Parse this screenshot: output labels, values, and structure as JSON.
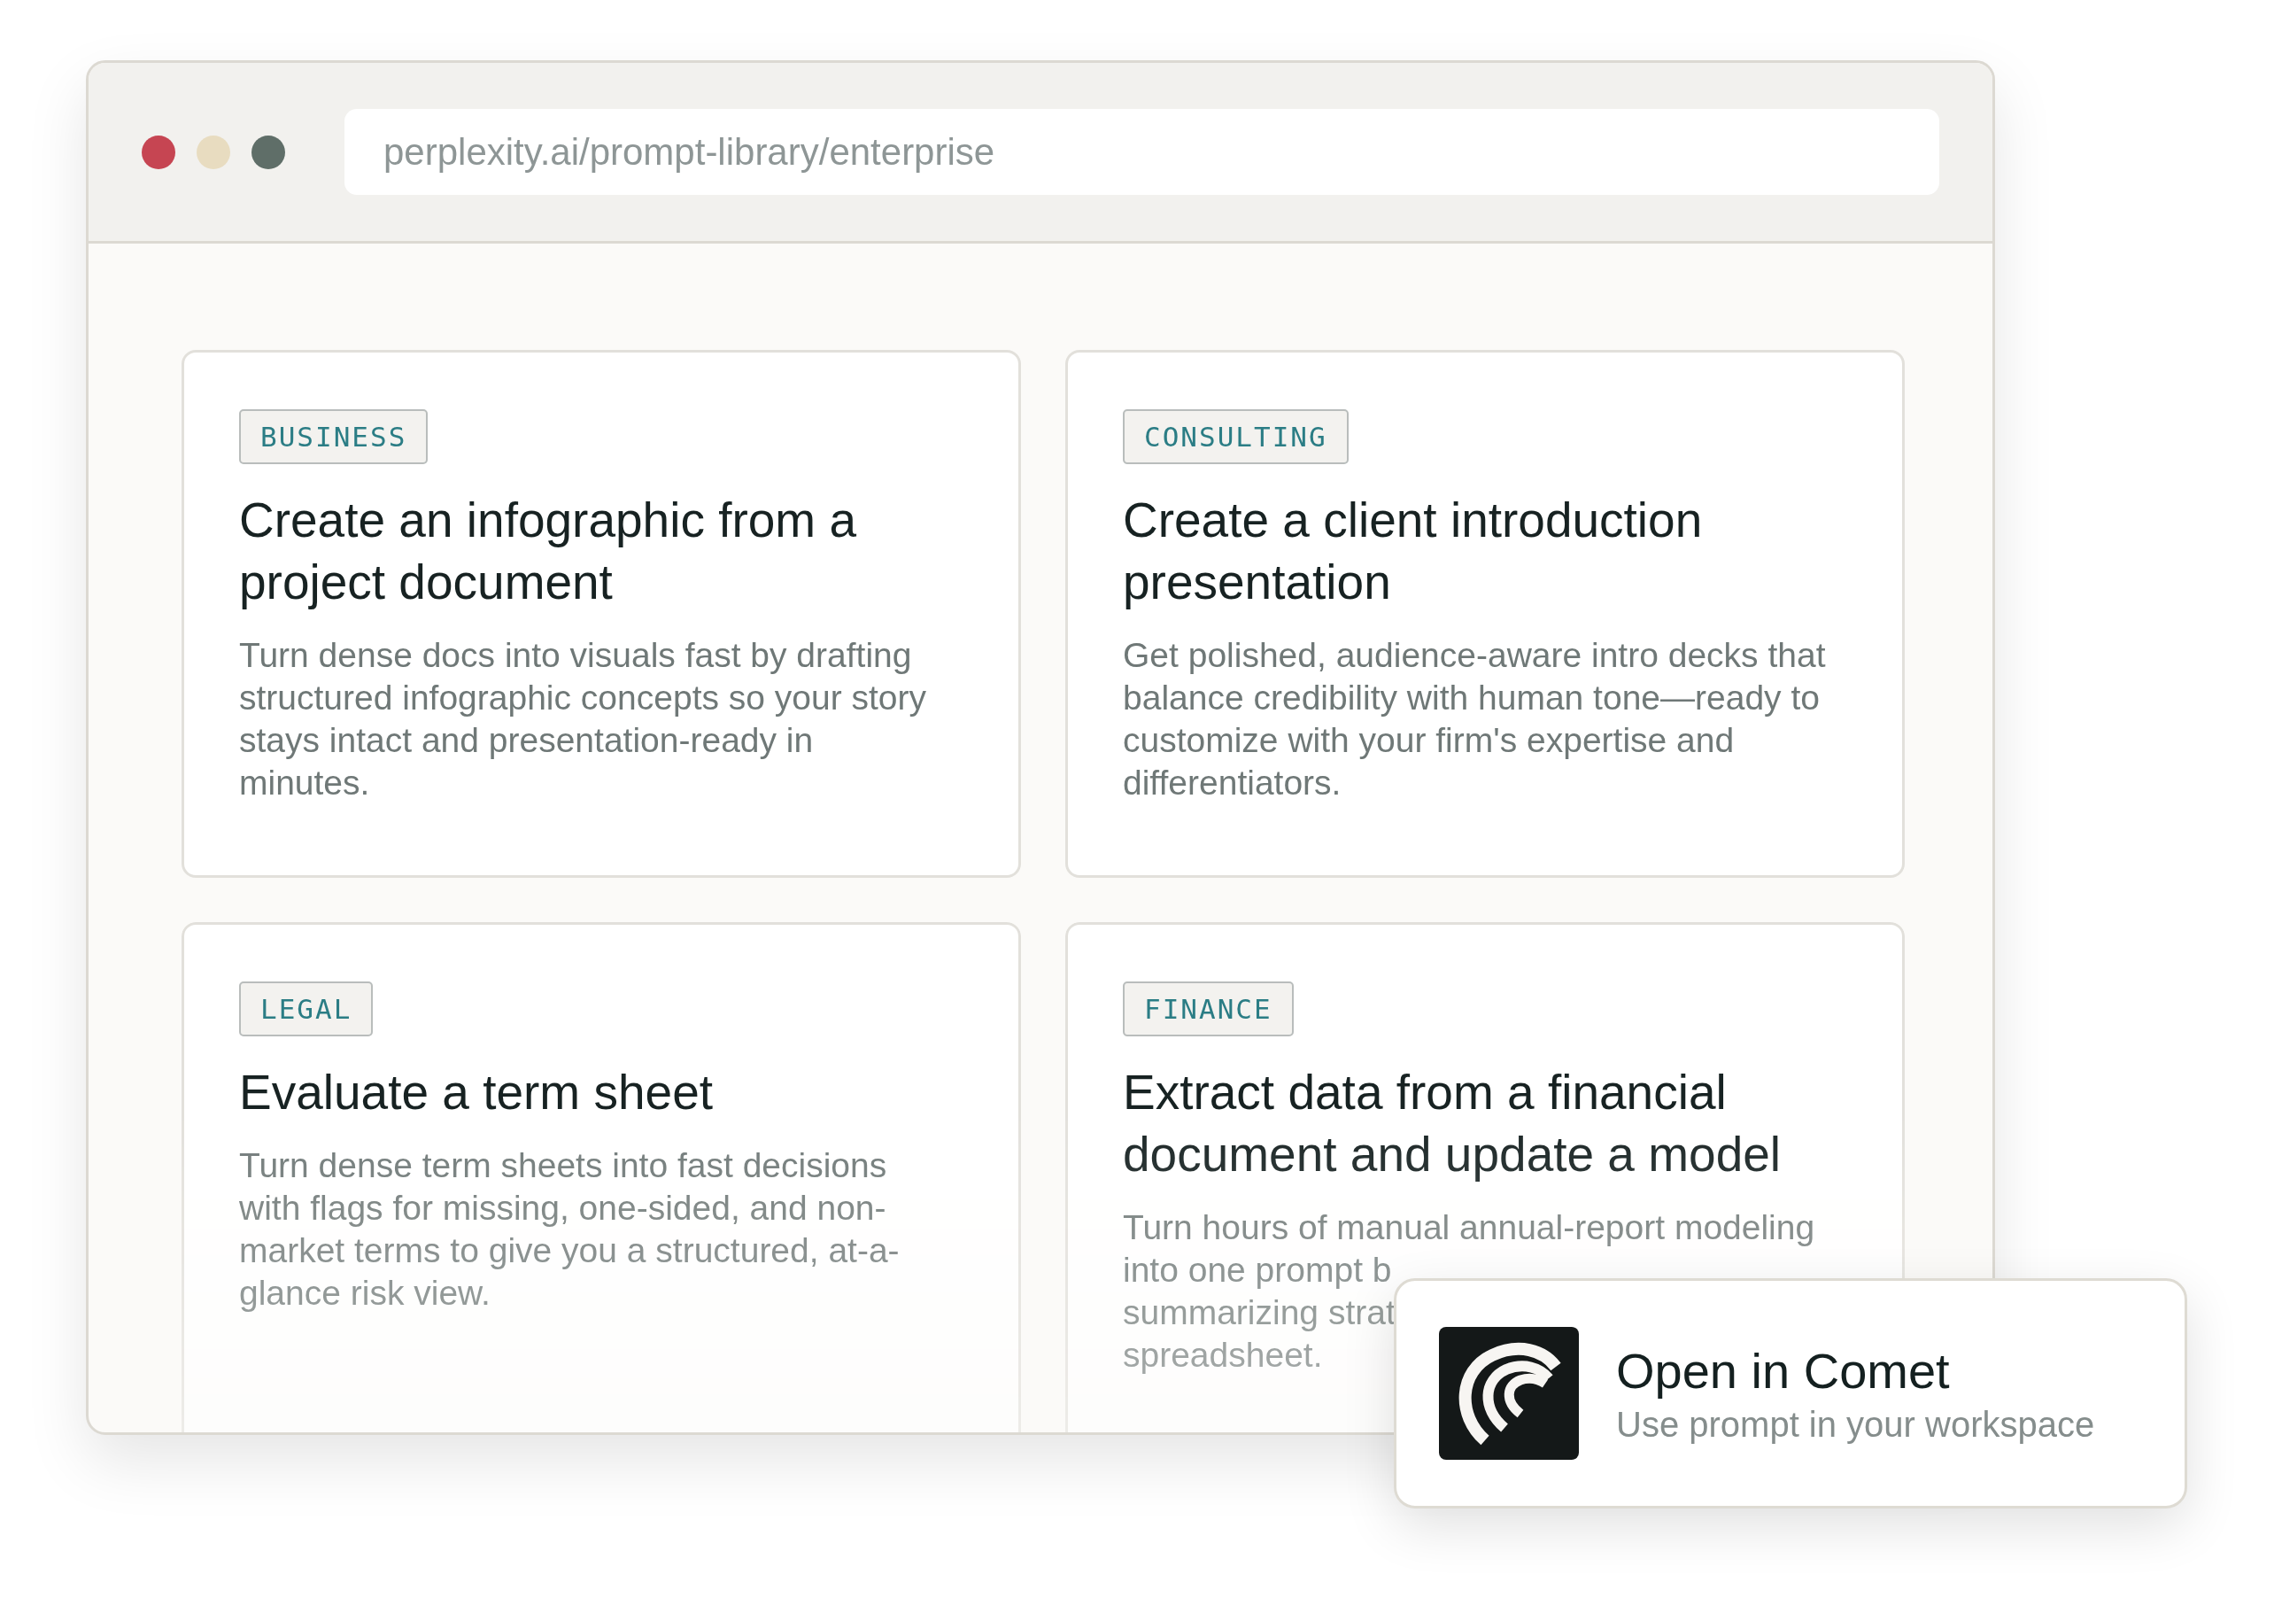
{
  "window": {
    "traffic_lights": [
      {
        "color": "#c64552"
      },
      {
        "color": "#e8dcc0"
      },
      {
        "color": "#5f6e68"
      }
    ],
    "url": "perplexity.ai/prompt-library/enterprise"
  },
  "cards": [
    {
      "tag": "BUSINESS",
      "title": "Create an infographic from a project document",
      "description": "Turn dense docs into visuals fast by drafting structured infographic concepts so your story stays intact and presentation-ready in minutes."
    },
    {
      "tag": "CONSULTING",
      "title": "Create a client introduction presentation",
      "description": "Get polished, audience-aware intro decks that balance credibility with human tone—ready to customize with your firm's expertise and differentiators."
    },
    {
      "tag": "LEGAL",
      "title": "Evaluate a term sheet",
      "description": "Turn dense term sheets into fast decisions with flags for missing, one-sided, and non-market terms to give you a structured, at-a-glance risk view."
    },
    {
      "tag": "FINANCE",
      "title": "Extract data from a financial document and update a model",
      "description_lines": [
        "Turn hours of manual annual-report modeling",
        "into one prompt b",
        "summarizing strat",
        "spreadsheet."
      ]
    }
  ],
  "popup": {
    "title": "Open in Comet",
    "subtitle": "Use prompt in your workspace"
  }
}
